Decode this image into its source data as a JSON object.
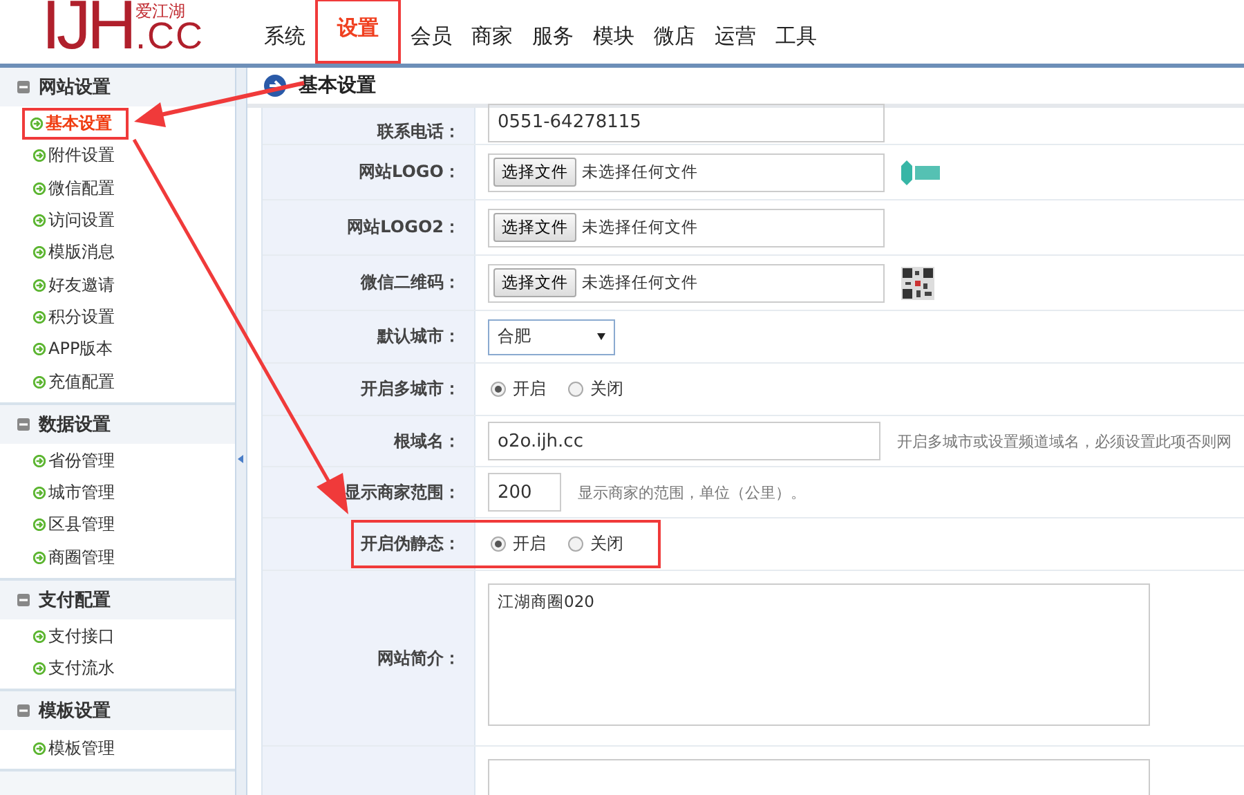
{
  "header": {
    "logo": {
      "letters": "IJH",
      "domain": ".CC",
      "tagline": "爱江湖"
    },
    "nav": [
      {
        "label": "系统",
        "selected": false,
        "annotated": false
      },
      {
        "label": "设置",
        "selected": true,
        "annotated": true
      },
      {
        "label": "会员",
        "selected": false,
        "annotated": false
      },
      {
        "label": "商家",
        "selected": false,
        "annotated": false
      },
      {
        "label": "服务",
        "selected": false,
        "annotated": false
      },
      {
        "label": "模块",
        "selected": false,
        "annotated": false
      },
      {
        "label": "微店",
        "selected": false,
        "annotated": false
      },
      {
        "label": "运营",
        "selected": false,
        "annotated": false
      },
      {
        "label": "工具",
        "selected": false,
        "annotated": false
      }
    ]
  },
  "sidebar": {
    "groups": [
      {
        "title": "网站设置",
        "expanded": true,
        "items": [
          {
            "label": "基本设置",
            "selected": true,
            "annotated": true
          },
          {
            "label": "附件设置",
            "selected": false,
            "annotated": false
          },
          {
            "label": "微信配置",
            "selected": false,
            "annotated": false
          },
          {
            "label": "访问设置",
            "selected": false,
            "annotated": false
          },
          {
            "label": "模版消息",
            "selected": false,
            "annotated": false
          },
          {
            "label": "好友邀请",
            "selected": false,
            "annotated": false
          },
          {
            "label": "积分设置",
            "selected": false,
            "annotated": false
          },
          {
            "label": "APP版本",
            "selected": false,
            "annotated": false
          },
          {
            "label": "充值配置",
            "selected": false,
            "annotated": false
          }
        ]
      },
      {
        "title": "数据设置",
        "expanded": true,
        "items": [
          {
            "label": "省份管理",
            "selected": false,
            "annotated": false
          },
          {
            "label": "城市管理",
            "selected": false,
            "annotated": false
          },
          {
            "label": "区县管理",
            "selected": false,
            "annotated": false
          },
          {
            "label": "商圈管理",
            "selected": false,
            "annotated": false
          }
        ]
      },
      {
        "title": "支付配置",
        "expanded": true,
        "items": [
          {
            "label": "支付接口",
            "selected": false,
            "annotated": false
          },
          {
            "label": "支付流水",
            "selected": false,
            "annotated": false
          }
        ]
      },
      {
        "title": "模板设置",
        "expanded": true,
        "items": [
          {
            "label": "模板管理",
            "selected": false,
            "annotated": false
          }
        ]
      }
    ]
  },
  "panel": {
    "title": "基本设置"
  },
  "form": {
    "rows": [
      {
        "kind": "text",
        "label": "联系电话：",
        "value": "0551-64278115"
      },
      {
        "kind": "file",
        "label": "网站LOGO：",
        "button": "选择文件",
        "status": "未选择任何文件",
        "preview": {
          "kind": "logo"
        }
      },
      {
        "kind": "file",
        "label": "网站LOGO2：",
        "button": "选择文件",
        "status": "未选择任何文件"
      },
      {
        "kind": "file",
        "label": "微信二维码：",
        "button": "选择文件",
        "status": "未选择任何文件",
        "preview": {
          "kind": "qr"
        }
      },
      {
        "kind": "select",
        "label": "默认城市：",
        "value": "合肥"
      },
      {
        "kind": "radio",
        "label": "开启多城市：",
        "options": [
          {
            "label": "开启",
            "selected": true
          },
          {
            "label": "关闭",
            "selected": false
          }
        ]
      },
      {
        "kind": "text",
        "label": "根域名：",
        "value": "o2o.ijh.cc",
        "hint": "开启多城市或设置频道域名，必须设置此项否则网"
      },
      {
        "kind": "short",
        "label": "显示商家范围：",
        "value": "200",
        "hint": "显示商家的范围，单位（公里）。"
      },
      {
        "kind": "radio",
        "label": "开启伪静态：",
        "options": [
          {
            "label": "开启",
            "selected": true
          },
          {
            "label": "关闭",
            "selected": false
          }
        ],
        "annotated": true
      },
      {
        "kind": "textarea",
        "label": "网站简介：",
        "value": "江湖商圈020"
      },
      {
        "kind": "textarea"
      }
    ]
  }
}
